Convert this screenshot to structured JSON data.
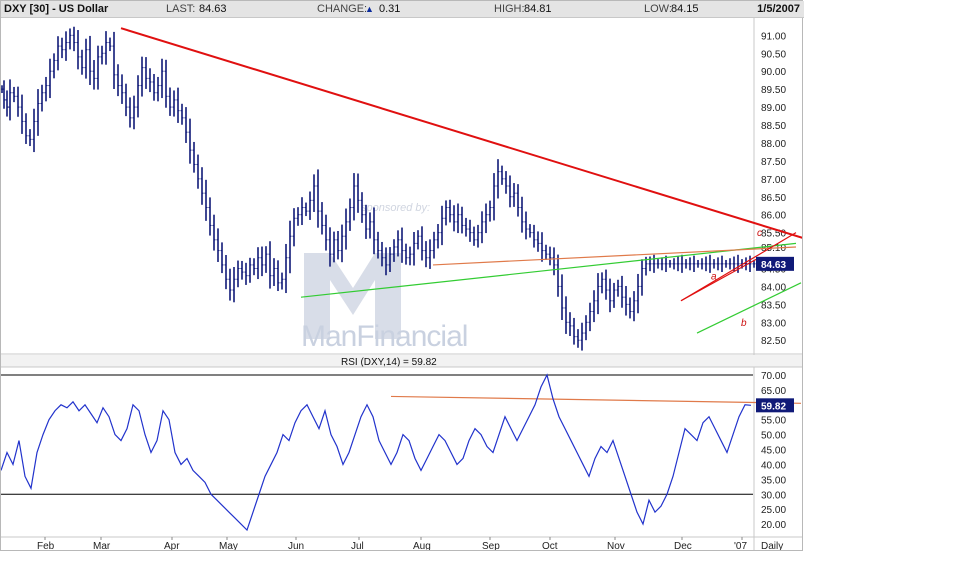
{
  "header": {
    "title": "DXY [30] - US Dollar",
    "last_label": "LAST:",
    "last_value": "84.63",
    "change_label": "CHANGE:",
    "change_value": "0.31",
    "high_label": "HIGH:",
    "high_value": "84.81",
    "low_label": "LOW:",
    "low_value": "84.15",
    "date": "1/5/2007",
    "change_direction_icon": "up-triangle-icon"
  },
  "chart_data": [
    {
      "type": "bar",
      "title": "DXY [30] - US Dollar",
      "y_axis": {
        "ylim": [
          82.2,
          91.4
        ],
        "ticks": [
          "91.00",
          "90.50",
          "90.00",
          "89.50",
          "89.00",
          "88.50",
          "88.00",
          "87.50",
          "87.00",
          "86.50",
          "86.00",
          "85.50",
          "85.10",
          "84.50",
          "84.00",
          "83.50",
          "83.00",
          "82.50"
        ],
        "tick_values": [
          91.0,
          90.5,
          90.0,
          89.5,
          89.0,
          88.5,
          88.0,
          87.5,
          87.0,
          86.5,
          86.0,
          85.5,
          85.1,
          84.5,
          84.0,
          83.5,
          83.0,
          82.5
        ],
        "current_value_label": "84.63",
        "current_value": 84.63
      },
      "x_axis": {
        "labels": [
          "Feb",
          "Mar",
          "Apr",
          "May",
          "Jun",
          "Jul",
          "Aug",
          "Sep",
          "Oct",
          "Nov",
          "Dec",
          "'07"
        ],
        "period_label": "Daily"
      },
      "price_series": {
        "name": "DXY",
        "x": [
          0,
          2,
          5,
          8,
          12,
          16,
          20,
          24,
          28,
          32,
          36,
          40,
          44,
          48,
          52,
          56,
          60,
          64,
          68,
          72,
          76,
          80,
          84,
          88,
          92,
          96,
          100,
          104,
          108,
          112,
          116,
          120,
          124,
          128,
          132,
          136,
          140,
          144,
          148,
          152,
          156,
          160,
          164,
          168,
          172,
          176,
          180,
          184,
          188,
          192,
          196,
          200,
          204,
          208,
          212,
          216,
          220,
          224,
          228,
          232,
          236,
          240,
          244,
          248,
          252,
          256,
          260,
          264,
          268,
          272,
          276,
          280,
          284,
          288,
          292,
          296,
          300,
          304,
          308,
          312,
          316,
          320,
          324,
          328,
          332,
          336,
          340,
          344,
          348,
          352,
          356,
          360,
          364,
          368,
          372,
          376,
          380,
          384,
          388,
          392,
          396,
          400,
          404,
          408,
          412,
          416,
          420,
          424,
          428,
          432,
          436,
          440,
          444,
          448,
          452,
          456,
          460,
          464,
          468,
          472,
          476,
          480,
          484,
          488,
          492,
          496,
          500,
          504,
          508,
          512,
          516,
          520,
          524,
          528,
          532,
          536,
          540,
          544,
          548,
          552,
          556,
          560,
          564,
          568,
          572,
          576,
          580,
          584,
          588,
          592,
          596,
          600,
          604,
          608,
          612,
          616,
          620,
          624,
          628,
          632,
          636,
          640,
          644,
          648,
          652,
          656,
          660,
          664,
          668,
          672,
          676,
          680,
          684,
          688,
          692,
          696,
          700,
          704,
          708,
          712,
          716,
          720,
          724,
          728,
          732,
          736,
          740,
          744,
          748,
          752
        ],
        "close": [
          89.5,
          89.2,
          89.0,
          89.4,
          89.3,
          89.0,
          88.6,
          88.2,
          88.1,
          88.6,
          89.1,
          89.4,
          89.6,
          90.0,
          90.3,
          90.7,
          90.6,
          90.8,
          91.0,
          90.8,
          90.4,
          90.1,
          90.6,
          90.0,
          89.8,
          90.4,
          90.5,
          90.8,
          90.7,
          89.9,
          89.6,
          89.4,
          89.0,
          88.7,
          89.0,
          89.6,
          90.1,
          89.8,
          89.7,
          89.4,
          89.6,
          90.0,
          89.3,
          89.0,
          89.2,
          88.9,
          88.7,
          88.3,
          87.8,
          87.4,
          87.0,
          86.6,
          86.2,
          85.7,
          85.3,
          85.0,
          84.6,
          84.2,
          83.9,
          84.2,
          84.5,
          84.4,
          84.3,
          84.6,
          84.5,
          84.8,
          84.6,
          84.9,
          84.3,
          84.5,
          84.1,
          84.2,
          84.8,
          85.4,
          85.9,
          86.0,
          86.2,
          86.1,
          86.4,
          86.8,
          86.1,
          85.7,
          85.3,
          84.9,
          85.3,
          85.0,
          85.4,
          85.8,
          86.2,
          86.8,
          86.4,
          86.0,
          85.6,
          85.8,
          85.3,
          85.0,
          84.8,
          84.6,
          84.9,
          85.1,
          85.3,
          85.0,
          84.8,
          84.9,
          85.2,
          85.4,
          85.0,
          84.8,
          85.0,
          85.3,
          85.5,
          85.9,
          86.2,
          86.0,
          85.8,
          86.0,
          85.7,
          85.6,
          85.5,
          85.3,
          85.5,
          85.8,
          86.0,
          86.2,
          86.8,
          87.2,
          87.0,
          86.8,
          86.5,
          86.6,
          86.2,
          85.8,
          85.6,
          85.5,
          85.3,
          85.2,
          85.0,
          84.9,
          84.8,
          84.6,
          84.0,
          83.4,
          83.0,
          82.9,
          82.6,
          82.5,
          82.7,
          83.0,
          83.3,
          83.6,
          84.0,
          84.2,
          83.9,
          83.6,
          83.9,
          84.0,
          83.7,
          83.5,
          83.3,
          83.6,
          84.0,
          84.5,
          84.63,
          84.63,
          84.63,
          84.63,
          84.63,
          84.63,
          84.63,
          84.63,
          84.63,
          84.63,
          84.63,
          84.63,
          84.63,
          84.63,
          84.63,
          84.63,
          84.63,
          84.63,
          84.63,
          84.63,
          84.63,
          84.63,
          84.63,
          84.63,
          84.63,
          84.63,
          84.63,
          84.63,
          84.63,
          84.63
        ]
      },
      "trendlines": [
        {
          "name": "",
          "color": "#e01010",
          "from": [
            120,
            91.2
          ],
          "to": [
            802,
            85.35
          ]
        },
        {
          "name": "",
          "color": "#33cc33",
          "from": [
            300,
            83.7
          ],
          "to": [
            795,
            85.2
          ]
        },
        {
          "name": "",
          "color": "#e07a4a",
          "from": [
            432,
            84.6
          ],
          "to": [
            795,
            85.1
          ]
        },
        {
          "name": "",
          "color": "#e01010",
          "from": [
            680,
            83.6
          ],
          "to": [
            795,
            85.5
          ]
        },
        {
          "name": "",
          "color": "#33cc33",
          "from": [
            696,
            82.7
          ],
          "to": [
            800,
            84.1
          ]
        },
        {
          "name": "",
          "color": "#e01010",
          "from": [
            680,
            83.6
          ],
          "to": [
            758,
            84.8
          ]
        }
      ],
      "annotations": [
        {
          "text": "a",
          "x": 710,
          "y": 84.2
        },
        {
          "text": "b",
          "x": 740,
          "y": 82.9
        },
        {
          "text": "c",
          "x": 756,
          "y": 85.4
        }
      ],
      "watermark": "ManFinancial",
      "watermark_small": "sponsored by:",
      "grid": false
    },
    {
      "type": "line",
      "title": "RSI (DXY,14) = 59.82",
      "y_axis": {
        "ylim": [
          16,
          72
        ],
        "ticks": [
          "70.00",
          "65.00",
          "60.00",
          "55.00",
          "50.00",
          "45.00",
          "40.00",
          "35.00",
          "30.00",
          "25.00",
          "20.00"
        ],
        "tick_values": [
          70,
          65,
          60,
          55,
          50,
          45,
          40,
          35,
          30,
          25,
          20
        ],
        "reference_lines": [
          70,
          30
        ],
        "current_value_label": "59.82",
        "current_value": 59.82
      },
      "series": [
        {
          "name": "RSI",
          "x": [
            0,
            6,
            12,
            18,
            24,
            30,
            36,
            42,
            48,
            54,
            60,
            66,
            72,
            78,
            84,
            90,
            96,
            102,
            108,
            114,
            120,
            126,
            132,
            138,
            144,
            150,
            156,
            162,
            168,
            174,
            180,
            186,
            192,
            198,
            204,
            210,
            216,
            222,
            228,
            234,
            240,
            246,
            252,
            258,
            264,
            270,
            276,
            282,
            288,
            294,
            300,
            306,
            312,
            318,
            324,
            330,
            336,
            342,
            348,
            354,
            360,
            366,
            372,
            378,
            384,
            390,
            396,
            402,
            408,
            414,
            420,
            426,
            432,
            438,
            444,
            450,
            456,
            462,
            468,
            474,
            480,
            486,
            492,
            498,
            504,
            510,
            516,
            522,
            528,
            534,
            540,
            546,
            552,
            558,
            564,
            570,
            576,
            582,
            588,
            594,
            600,
            606,
            612,
            618,
            624,
            630,
            636,
            642,
            648,
            654,
            660,
            666,
            672,
            678,
            684,
            690,
            696,
            702,
            708,
            714,
            720,
            726,
            732,
            738,
            744,
            750
          ],
          "values": [
            38,
            44,
            40,
            48,
            36,
            32,
            44,
            50,
            55,
            58,
            60,
            59,
            61,
            58,
            60,
            57,
            54,
            59,
            56,
            50,
            48,
            52,
            60,
            58,
            50,
            44,
            48,
            58,
            55,
            44,
            40,
            42,
            38,
            36,
            34,
            30,
            28,
            26,
            24,
            22,
            20,
            18,
            24,
            30,
            36,
            40,
            44,
            50,
            48,
            54,
            58,
            60,
            56,
            52,
            58,
            50,
            46,
            40,
            44,
            50,
            56,
            60,
            56,
            48,
            44,
            40,
            44,
            50,
            48,
            42,
            38,
            42,
            46,
            50,
            48,
            44,
            40,
            42,
            48,
            52,
            50,
            46,
            44,
            50,
            56,
            52,
            48,
            52,
            56,
            60,
            66,
            70,
            62,
            56,
            52,
            48,
            44,
            40,
            36,
            42,
            46,
            44,
            48,
            42,
            36,
            30,
            24,
            20,
            28,
            24,
            26,
            30,
            36,
            44,
            52,
            50,
            48,
            54,
            56,
            52,
            48,
            44,
            50,
            56,
            60,
            59.82
          ]
        }
      ],
      "trendlines": [
        {
          "name": "",
          "color": "#e07a4a",
          "from": [
            390,
            62.8
          ],
          "to": [
            800,
            60.5
          ]
        }
      ]
    }
  ]
}
